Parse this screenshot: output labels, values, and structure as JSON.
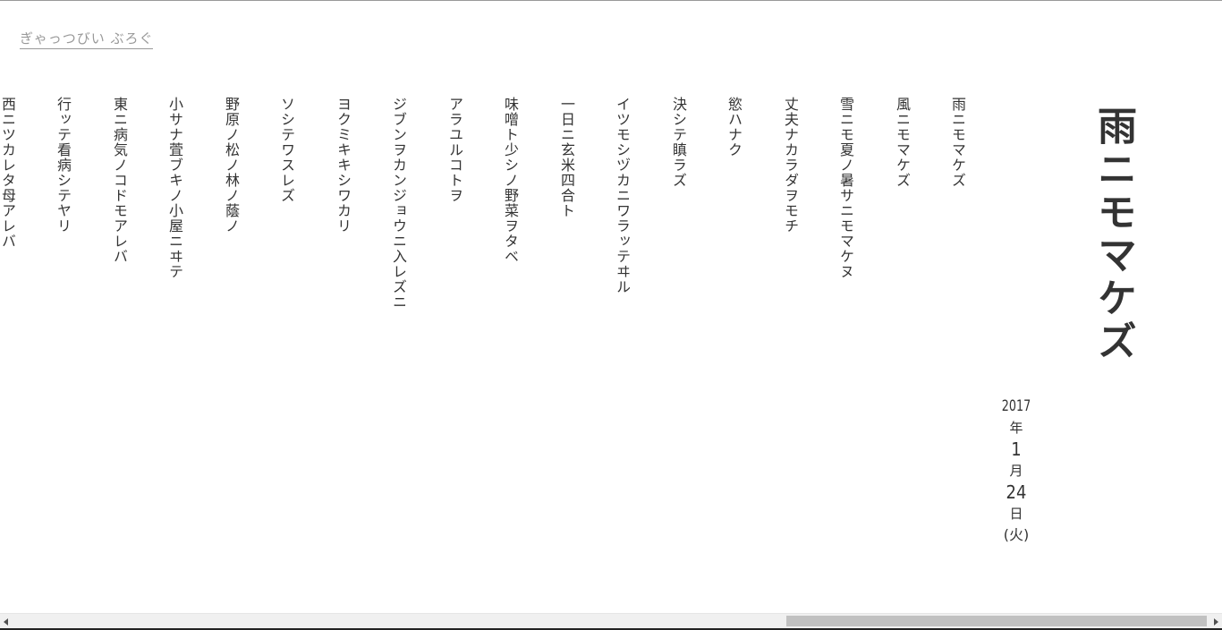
{
  "site": {
    "title": "ぎゃっつびい ぶろぐ"
  },
  "post": {
    "title": "雨ニモマケズ",
    "date": {
      "year": "2017",
      "year_kanji": "年",
      "month": "1",
      "month_kanji": "月",
      "day": "24",
      "day_kanji": "日",
      "weekday": "(火)"
    },
    "lines": [
      "雨ニモマケズ",
      "風ニモマケズ",
      "雪ニモ夏ノ暑サニモマケヌ",
      "丈夫ナカラダヲモチ",
      "慾ハナク",
      "決シテ瞋ラズ",
      "イツモシヅカニワラッテヰル",
      "一日ニ玄米四合ト",
      "味噌ト少シノ野菜ヲタベ",
      "アラユルコトヲ",
      "ジブンヲカンジョウニ入レズニ",
      "ヨクミキキシワカリ",
      "ソシテワスレズ",
      "野原ノ松ノ林ノ蔭ノ",
      "小サナ萓ブキノ小屋ニヰテ",
      "東ニ病気ノコドモアレバ",
      "行ッテ看病シテヤリ",
      "西ニツカレタ母アレバ"
    ]
  },
  "scrollbar": {
    "left_arrow": "scroll-left",
    "right_arrow": "scroll-right"
  }
}
